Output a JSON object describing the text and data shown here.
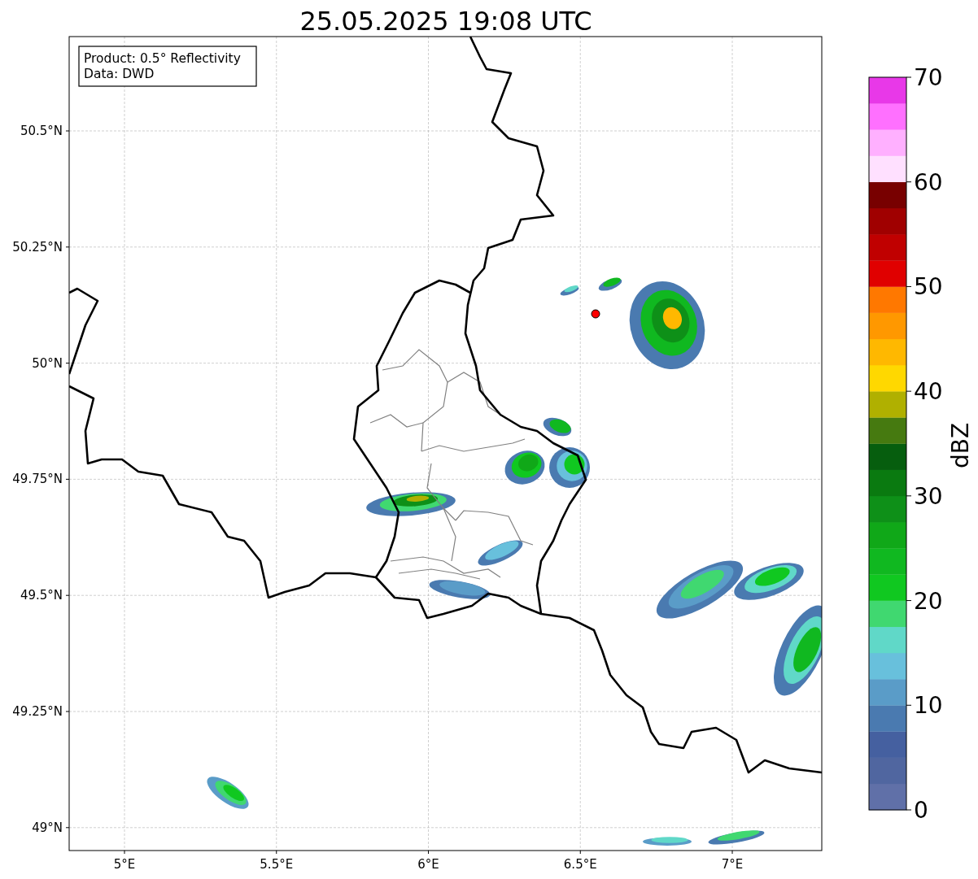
{
  "title": "25.05.2025 19:08 UTC",
  "info_box": {
    "lines": [
      "Product: 0.5° Reflectivity",
      "Data: DWD"
    ]
  },
  "map": {
    "xticks": [
      "5°E",
      "5.5°E",
      "6°E",
      "6.5°E",
      "7°E"
    ],
    "yticks": [
      "50.5°N",
      "50.25°N",
      "50°N",
      "49.75°N",
      "49.5°N",
      "49.25°N",
      "49°N"
    ]
  },
  "colorbar": {
    "label": "dBZ",
    "ticks": [
      "70",
      "60",
      "50",
      "40",
      "30",
      "20",
      "10",
      "0"
    ],
    "segments": [
      {
        "color": "#6070a8"
      },
      {
        "color": "#5066a0"
      },
      {
        "color": "#4560a0"
      },
      {
        "color": "#4a7ab0"
      },
      {
        "color": "#5a9cc8"
      },
      {
        "color": "#68c0dc"
      },
      {
        "color": "#60d8c8"
      },
      {
        "color": "#40d870"
      },
      {
        "color": "#10c820"
      },
      {
        "color": "#10b820"
      },
      {
        "color": "#10a818"
      },
      {
        "color": "#0e9018"
      },
      {
        "color": "#0a7a10"
      },
      {
        "color": "#065e0e"
      },
      {
        "color": "#467a10"
      },
      {
        "color": "#b0b000"
      },
      {
        "color": "#ffd800"
      },
      {
        "color": "#ffb800"
      },
      {
        "color": "#ff9800"
      },
      {
        "color": "#ff7800"
      },
      {
        "color": "#e00000"
      },
      {
        "color": "#c00000"
      },
      {
        "color": "#a00000"
      },
      {
        "color": "#780000"
      },
      {
        "color": "#ffe0ff"
      },
      {
        "color": "#ffb0ff"
      },
      {
        "color": "#ff70ff"
      },
      {
        "color": "#e838e8"
      }
    ]
  }
}
